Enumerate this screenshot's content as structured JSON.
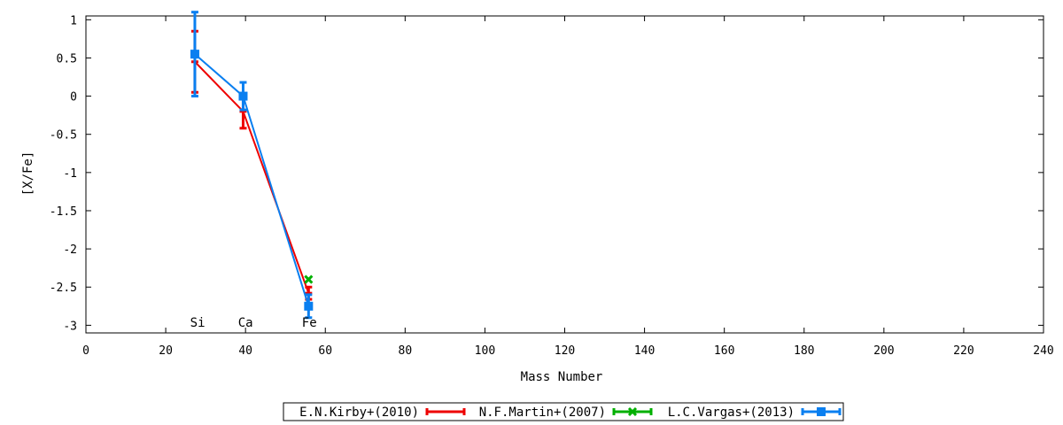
{
  "chart_data": {
    "type": "line",
    "title": "",
    "xlabel": "Mass Number",
    "ylabel": "[X/Fe]",
    "xlim": [
      0,
      240
    ],
    "ylim": [
      -3.1,
      1.05
    ],
    "xticks": [
      0,
      20,
      40,
      60,
      80,
      100,
      120,
      140,
      160,
      180,
      200,
      220,
      240
    ],
    "yticks": [
      1,
      0.5,
      0,
      -0.5,
      -1,
      -1.5,
      -2,
      -2.5,
      -3
    ],
    "ytick_labels": [
      "1",
      "0.5",
      "0",
      "-0.5",
      "-1",
      "-1.5",
      "-2",
      "-2.5",
      "-3"
    ],
    "grid": false,
    "legend_position": "bottom",
    "annotations": [
      {
        "text": "Si",
        "x": 28
      },
      {
        "text": "Ca",
        "x": 40
      },
      {
        "text": "Fe",
        "x": 56
      }
    ],
    "series": [
      {
        "name": "E.N.Kirby+(2010)",
        "color": "#ee0000",
        "marker": "dash",
        "points": [
          {
            "x": 27.3,
            "y": 0.45,
            "err": 0.4
          },
          {
            "x": 39.4,
            "y": -0.2,
            "err": 0.22
          },
          {
            "x": 55.8,
            "y": -2.58,
            "err": 0.08
          }
        ]
      },
      {
        "name": "N.F.Martin+(2007)",
        "color": "#00b000",
        "marker": "x",
        "points": [
          {
            "x": 55.8,
            "y": -2.4,
            "err": 0.0
          }
        ]
      },
      {
        "name": "L.C.Vargas+(2013)",
        "color": "#0a7ff0",
        "marker": "square",
        "points": [
          {
            "x": 27.3,
            "y": 0.55,
            "err": 0.55
          },
          {
            "x": 39.4,
            "y": 0.0,
            "err": 0.18
          },
          {
            "x": 55.8,
            "y": -2.75,
            "err": 0.15
          }
        ]
      }
    ]
  }
}
